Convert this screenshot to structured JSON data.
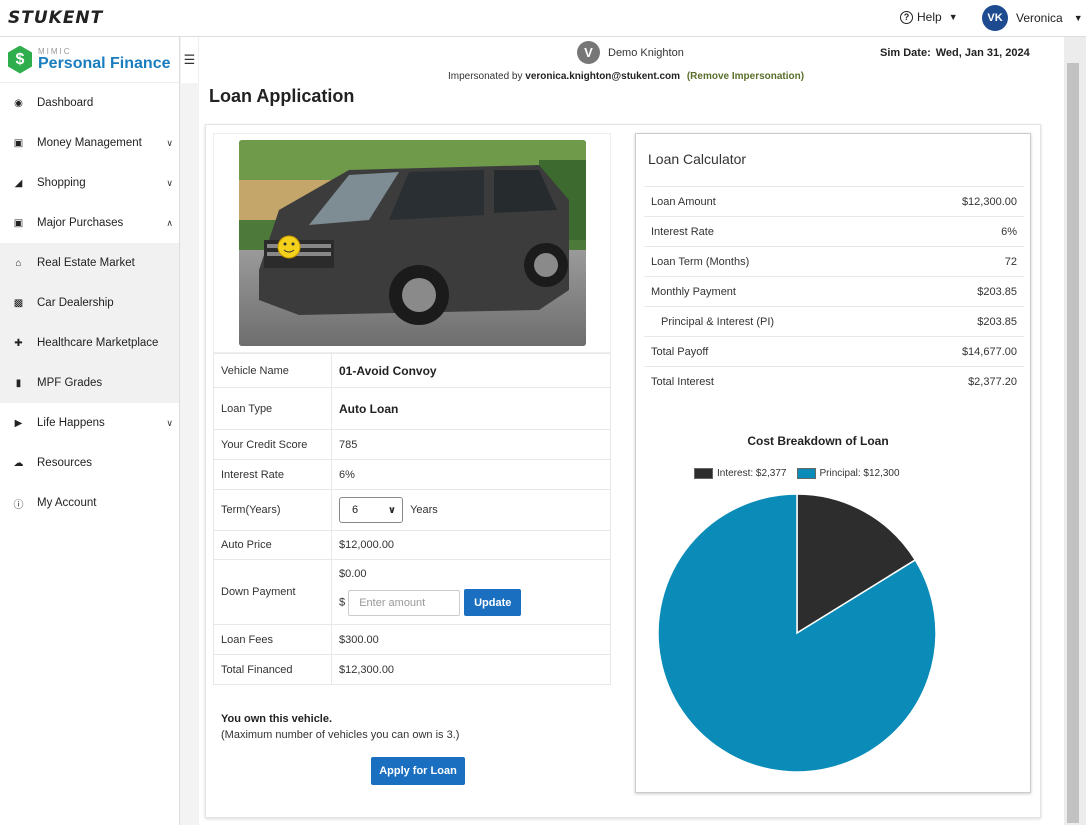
{
  "header": {
    "brand": "STUKENT",
    "help": "Help",
    "user_initials": "VK",
    "user_name": "Veronica"
  },
  "sidebar": {
    "logo_mimic": "MIMIC",
    "logo_title": "Personal Finance",
    "items": [
      {
        "label": "Dashboard",
        "icon": "dashboard-icon"
      },
      {
        "label": "Money Management",
        "icon": "money-icon"
      },
      {
        "label": "Shopping",
        "icon": "cart-icon"
      },
      {
        "label": "Major Purchases",
        "icon": "money-icon"
      },
      {
        "label": "Real Estate Market",
        "icon": "home-icon"
      },
      {
        "label": "Car Dealership",
        "icon": "car-icon"
      },
      {
        "label": "Healthcare Marketplace",
        "icon": "medkit-icon"
      },
      {
        "label": "MPF Grades",
        "icon": "signal-icon"
      },
      {
        "label": "Life Happens",
        "icon": "play-circle-icon"
      },
      {
        "label": "Resources",
        "icon": "cloud-download-icon"
      },
      {
        "label": "My Account",
        "icon": "info-circle-icon"
      }
    ]
  },
  "impersonation": {
    "initial": "V",
    "name": "Demo Knighton",
    "prefix": "Impersonated by",
    "email": "veronica.knighton@stukent.com",
    "remove": "(Remove Impersonation)"
  },
  "sim_date": {
    "label": "Sim Date:",
    "value": "Wed, Jan 31, 2024"
  },
  "page_title": "Loan Application",
  "loan": {
    "vehicle_name_label": "Vehicle Name",
    "vehicle_name": "01-Avoid Convoy",
    "loan_type_label": "Loan Type",
    "loan_type": "Auto Loan",
    "credit_label": "Your Credit Score",
    "credit": "785",
    "rate_label": "Interest Rate",
    "rate": "6%",
    "term_label": "Term(Years)",
    "term_value": "6",
    "term_unit": "Years",
    "price_label": "Auto Price",
    "price": "$12,000.00",
    "down_label": "Down Payment",
    "down_value": "$0.00",
    "currency": "$",
    "down_placeholder": "Enter amount",
    "update": "Update",
    "fees_label": "Loan Fees",
    "fees": "$300.00",
    "financed_label": "Total Financed",
    "financed": "$12,300.00"
  },
  "ownership": {
    "own": "You own this vehicle.",
    "max": "(Maximum number of vehicles you can own is 3.)",
    "apply": "Apply for Loan"
  },
  "calculator": {
    "title": "Loan Calculator",
    "rows": [
      {
        "label": "Loan Amount",
        "value": "$12,300.00"
      },
      {
        "label": "Interest Rate",
        "value": "6%"
      },
      {
        "label": "Loan Term (Months)",
        "value": "72"
      },
      {
        "label": "Monthly Payment",
        "value": "$203.85"
      },
      {
        "label": "Principal & Interest (PI)",
        "value": "$203.85"
      },
      {
        "label": "Total Payoff",
        "value": "$14,677.00"
      },
      {
        "label": "Total Interest",
        "value": "$2,377.20"
      }
    ]
  },
  "chart_data": {
    "type": "pie",
    "title": "Cost Breakdown of Loan",
    "categories": [
      "Interest",
      "Principal"
    ],
    "values": [
      2377,
      12300
    ],
    "legend": [
      "Interest: $2,377",
      "Principal: $12,300"
    ],
    "colors": [
      "#2d2d2d",
      "#0b8bb8"
    ],
    "legend_position": "top"
  }
}
